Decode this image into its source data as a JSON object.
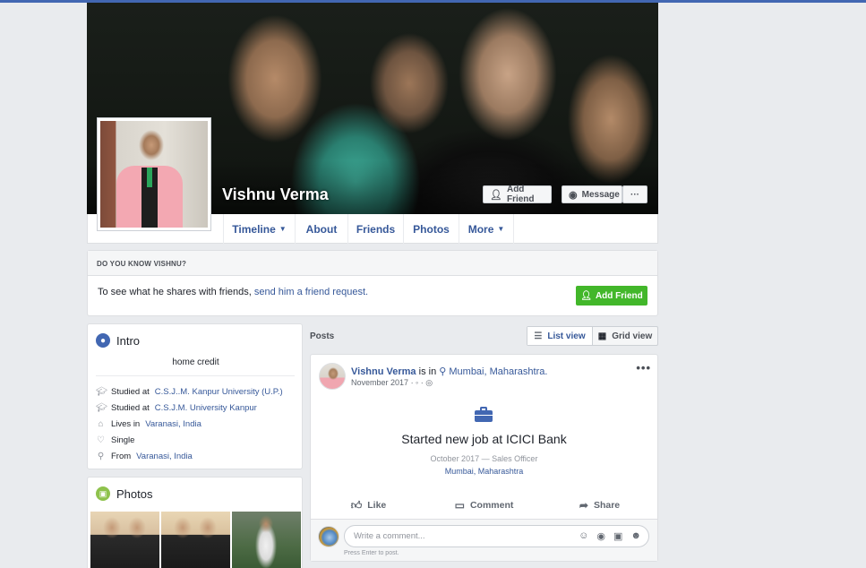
{
  "profile": {
    "name": "Vishnu Verma",
    "add_friend_label": "Add Friend",
    "message_label": "Message",
    "more_dots": "···"
  },
  "nav": {
    "tabs": [
      {
        "label": "Timeline"
      },
      {
        "label": "About"
      },
      {
        "label": "Friends"
      },
      {
        "label": "Photos"
      },
      {
        "label": "More"
      }
    ]
  },
  "know": {
    "header": "DO YOU KNOW VISHNU?",
    "text": "To see what he shares with friends,",
    "link": "send him a friend request.",
    "button": "Add Friend"
  },
  "intro": {
    "title": "Intro",
    "bio": "home credit",
    "rows": [
      {
        "prefix": "Studied at",
        "link": "C.S.J..M. Kanpur University (U.P.)",
        "icon": "graduation-cap-icon"
      },
      {
        "prefix": "Studied at",
        "link": "C.S.J.M. University Kanpur",
        "icon": "graduation-cap-icon"
      },
      {
        "prefix": "Lives in",
        "link": "Varanasi, India",
        "icon": "home-icon"
      },
      {
        "prefix": "Single",
        "link": "",
        "icon": "heart-icon"
      },
      {
        "prefix": "From",
        "link": "Varanasi, India",
        "icon": "location-pin-icon"
      }
    ]
  },
  "photos": {
    "title": "Photos"
  },
  "posts": {
    "label": "Posts",
    "list_view": "List view",
    "grid_view": "Grid view"
  },
  "post": {
    "author": "Vishnu Verma",
    "is_in": "is in",
    "location": "Mumbai, Maharashtra.",
    "date": "November 2017",
    "date_suffix": "· ◦ · ◎",
    "more": "•••",
    "life_event_title": "Started new job at ICICI Bank",
    "life_event_sub": "October 2017 — Sales Officer",
    "life_event_loc": "Mumbai, Maharashtra",
    "like": "Like",
    "comment": "Comment",
    "share": "Share",
    "comment_placeholder": "Write a comment...",
    "comment_hint": "Press Enter to post."
  },
  "colors": {
    "brand": "#4267b2",
    "link": "#365899",
    "green": "#42b72a",
    "background": "#e9ebee"
  }
}
